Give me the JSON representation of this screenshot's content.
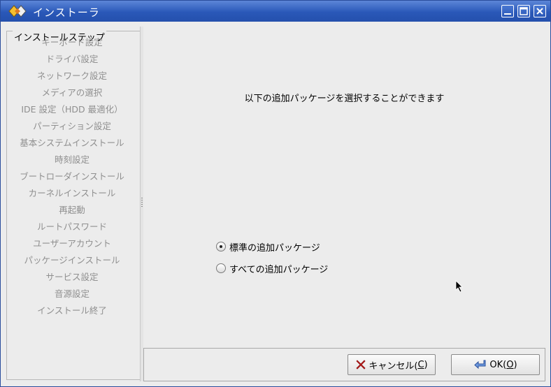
{
  "window": {
    "title": "インストーラ",
    "controls": [
      "minimize-icon",
      "maximize-icon",
      "close-icon"
    ]
  },
  "sidebar": {
    "group_title": "インストールステップ",
    "steps": [
      "キーボード設定",
      "ドライバ設定",
      "ネットワーク設定",
      "メディアの選択",
      "IDE 設定（HDD 最適化）",
      "パーティション設定",
      "基本システムインストール",
      "時刻設定",
      "ブートローダインストール",
      "カーネルインストール",
      "再起動",
      "ルートパスワード",
      "ユーザーアカウント",
      "パッケージインストール",
      "サービス設定",
      "音源設定",
      "インストール終了"
    ]
  },
  "main": {
    "headline": "以下の追加パッケージを選択することができます",
    "options": [
      {
        "label": "標準の追加パッケージ",
        "selected": true
      },
      {
        "label": "すべての追加パッケージ",
        "selected": false
      }
    ]
  },
  "buttons": {
    "cancel": {
      "label": "キャンセル(",
      "mnemonic": "C",
      "suffix": ")",
      "icon": "red-x-icon"
    },
    "ok": {
      "label": "OK(",
      "mnemonic": "O",
      "suffix": ")",
      "icon": "enter-arrow-icon"
    }
  },
  "colors": {
    "titlebar": "#2a58b8",
    "inactive_step_text": "#8f8f8f",
    "cancel_icon": "#d42020",
    "ok_icon": "#3a6fc4"
  }
}
